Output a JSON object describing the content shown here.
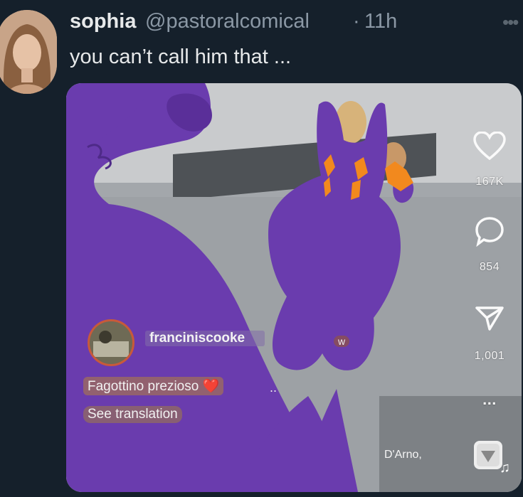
{
  "tweet": {
    "display_name": "sophia",
    "handle": "@pastoralcomical",
    "separator": "·",
    "time": "11h",
    "text": "you can’t call him that ...",
    "more_icon": "more-horizontal-icon"
  },
  "video": {
    "likes": "167K",
    "comments": "854",
    "shares": "1,001",
    "more_glyph": "...",
    "creator": "franciniscooke",
    "follow_label": "w",
    "caption": "Fagottino prezioso",
    "caption_emoji": "❤️",
    "caption_more": "..",
    "translate_label": "See translation",
    "sound_text": "D'Arno,",
    "colors": {
      "drawing_purple": "#6a3cae",
      "eye_orange": "#f2891e",
      "twitter_bg": "#15202b"
    }
  }
}
